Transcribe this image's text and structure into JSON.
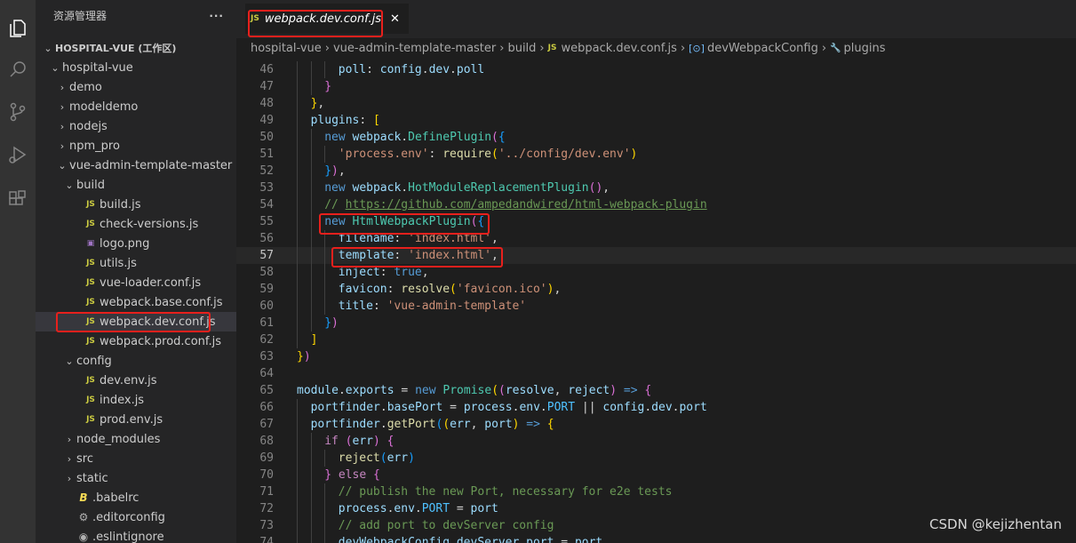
{
  "sidebar": {
    "title": "资源管理器",
    "more": "···",
    "tree": [
      {
        "label": "HOSPITAL-VUE (工作区)",
        "chev": "⌄",
        "icon": "",
        "depth": 0,
        "bold": true
      },
      {
        "label": "hospital-vue",
        "chev": "⌄",
        "icon": "",
        "depth": 1
      },
      {
        "label": "demo",
        "chev": "›",
        "icon": "",
        "depth": 2
      },
      {
        "label": "modeldemo",
        "chev": "›",
        "icon": "",
        "depth": 2
      },
      {
        "label": "nodejs",
        "chev": "›",
        "icon": "",
        "depth": 2
      },
      {
        "label": "npm_pro",
        "chev": "›",
        "icon": "",
        "depth": 2
      },
      {
        "label": "vue-admin-template-master",
        "chev": "⌄",
        "icon": "",
        "depth": 2
      },
      {
        "label": "build",
        "chev": "⌄",
        "icon": "",
        "depth": 3
      },
      {
        "label": "build.js",
        "chev": "",
        "icon": "JS",
        "depth": 4
      },
      {
        "label": "check-versions.js",
        "chev": "",
        "icon": "JS",
        "depth": 4
      },
      {
        "label": "logo.png",
        "chev": "",
        "icon": "▣",
        "depth": 4
      },
      {
        "label": "utils.js",
        "chev": "",
        "icon": "JS",
        "depth": 4
      },
      {
        "label": "vue-loader.conf.js",
        "chev": "",
        "icon": "JS",
        "depth": 4
      },
      {
        "label": "webpack.base.conf.js",
        "chev": "",
        "icon": "JS",
        "depth": 4
      },
      {
        "label": "webpack.dev.conf.js",
        "chev": "",
        "icon": "JS",
        "depth": 4,
        "selected": true
      },
      {
        "label": "webpack.prod.conf.js",
        "chev": "",
        "icon": "JS",
        "depth": 4
      },
      {
        "label": "config",
        "chev": "⌄",
        "icon": "",
        "depth": 3
      },
      {
        "label": "dev.env.js",
        "chev": "",
        "icon": "JS",
        "depth": 4
      },
      {
        "label": "index.js",
        "chev": "",
        "icon": "JS",
        "depth": 4
      },
      {
        "label": "prod.env.js",
        "chev": "",
        "icon": "JS",
        "depth": 4
      },
      {
        "label": "node_modules",
        "chev": "›",
        "icon": "",
        "depth": 3
      },
      {
        "label": "src",
        "chev": "›",
        "icon": "",
        "depth": 3
      },
      {
        "label": "static",
        "chev": "›",
        "icon": "",
        "depth": 3
      },
      {
        "label": ".babelrc",
        "chev": "",
        "icon": "B",
        "depth": 3
      },
      {
        "label": ".editorconfig",
        "chev": "",
        "icon": "⚙",
        "depth": 3
      },
      {
        "label": ".eslintignore",
        "chev": "",
        "icon": "◉",
        "depth": 3
      }
    ]
  },
  "tab": {
    "icon": "JS",
    "label": "webpack.dev.conf.js",
    "close": "✕"
  },
  "breadcrumb": {
    "parts": [
      "hospital-vue",
      "vue-admin-template-master",
      "build"
    ],
    "file_icon": "JS",
    "file": "webpack.dev.conf.js",
    "symbol_icon": "[⊙]",
    "symbol": "devWebpackConfig",
    "prop_icon": "🔧",
    "prop": "plugins",
    "sep": "›"
  },
  "editor": {
    "current_line": 57,
    "lines": [
      {
        "n": "46",
        "i": 3,
        "t": [
          [
            "var",
            "poll"
          ],
          [
            "pun",
            ": "
          ],
          [
            "var",
            "config"
          ],
          [
            "pun",
            "."
          ],
          [
            "var",
            "dev"
          ],
          [
            "pun",
            "."
          ],
          [
            "var",
            "poll"
          ]
        ]
      },
      {
        "n": "47",
        "i": 2,
        "t": [
          [
            "br2",
            "}"
          ]
        ]
      },
      {
        "n": "48",
        "i": 1,
        "t": [
          [
            "br1",
            "}"
          ],
          [
            "pun",
            ","
          ]
        ]
      },
      {
        "n": "49",
        "i": 1,
        "t": [
          [
            "var",
            "plugins"
          ],
          [
            "pun",
            ": "
          ],
          [
            "br1",
            "["
          ]
        ]
      },
      {
        "n": "50",
        "i": 2,
        "t": [
          [
            "kw",
            "new "
          ],
          [
            "var",
            "webpack"
          ],
          [
            "pun",
            "."
          ],
          [
            "cls",
            "DefinePlugin"
          ],
          [
            "br2",
            "("
          ],
          [
            "br3",
            "{"
          ]
        ]
      },
      {
        "n": "51",
        "i": 3,
        "t": [
          [
            "str",
            "'process.env'"
          ],
          [
            "pun",
            ": "
          ],
          [
            "fn",
            "require"
          ],
          [
            "br1",
            "("
          ],
          [
            "str",
            "'../config/dev.env'"
          ],
          [
            "br1",
            ")"
          ]
        ]
      },
      {
        "n": "52",
        "i": 2,
        "t": [
          [
            "br3",
            "}"
          ],
          [
            "br2",
            ")"
          ],
          [
            "pun",
            ","
          ]
        ]
      },
      {
        "n": "53",
        "i": 2,
        "t": [
          [
            "kw",
            "new "
          ],
          [
            "var",
            "webpack"
          ],
          [
            "pun",
            "."
          ],
          [
            "cls",
            "HotModuleReplacementPlugin"
          ],
          [
            "br2",
            "()"
          ],
          [
            "pun",
            ","
          ]
        ]
      },
      {
        "n": "54",
        "i": 2,
        "t": [
          [
            "cm",
            "// "
          ],
          [
            "link",
            "https://github.com/ampedandwired/html-webpack-plugin"
          ]
        ]
      },
      {
        "n": "55",
        "i": 2,
        "t": [
          [
            "kw",
            "new "
          ],
          [
            "cls",
            "HtmlWebpackPlugin"
          ],
          [
            "br2",
            "("
          ],
          [
            "br3",
            "{"
          ]
        ]
      },
      {
        "n": "56",
        "i": 3,
        "t": [
          [
            "var",
            "filename"
          ],
          [
            "pun",
            ": "
          ],
          [
            "str",
            "'index.html'"
          ],
          [
            "pun",
            ","
          ]
        ]
      },
      {
        "n": "57",
        "i": 3,
        "t": [
          [
            "var",
            "template"
          ],
          [
            "pun",
            ": "
          ],
          [
            "str",
            "'index.html'"
          ],
          [
            "pun",
            ","
          ]
        ]
      },
      {
        "n": "58",
        "i": 3,
        "t": [
          [
            "var",
            "inject"
          ],
          [
            "pun",
            ": "
          ],
          [
            "kw",
            "true"
          ],
          [
            "pun",
            ","
          ]
        ]
      },
      {
        "n": "59",
        "i": 3,
        "t": [
          [
            "var",
            "favicon"
          ],
          [
            "pun",
            ": "
          ],
          [
            "fn",
            "resolve"
          ],
          [
            "br1",
            "("
          ],
          [
            "str",
            "'favicon.ico'"
          ],
          [
            "br1",
            ")"
          ],
          [
            "pun",
            ","
          ]
        ]
      },
      {
        "n": "60",
        "i": 3,
        "t": [
          [
            "var",
            "title"
          ],
          [
            "pun",
            ": "
          ],
          [
            "str",
            "'vue-admin-template'"
          ]
        ]
      },
      {
        "n": "61",
        "i": 2,
        "t": [
          [
            "br3",
            "}"
          ],
          [
            "br2",
            ")"
          ]
        ]
      },
      {
        "n": "62",
        "i": 1,
        "t": [
          [
            "br1",
            "]"
          ]
        ]
      },
      {
        "n": "63",
        "i": 0,
        "t": [
          [
            "br1",
            "}"
          ],
          [
            "br2",
            ")"
          ]
        ]
      },
      {
        "n": "64",
        "i": 0,
        "t": []
      },
      {
        "n": "65",
        "i": 0,
        "t": [
          [
            "var",
            "module"
          ],
          [
            "pun",
            "."
          ],
          [
            "var",
            "exports"
          ],
          [
            "pun",
            " = "
          ],
          [
            "kw",
            "new "
          ],
          [
            "cls",
            "Promise"
          ],
          [
            "br1",
            "("
          ],
          [
            "br2",
            "("
          ],
          [
            "var",
            "resolve"
          ],
          [
            "pun",
            ", "
          ],
          [
            "var",
            "reject"
          ],
          [
            "br2",
            ")"
          ],
          [
            "kw",
            " => "
          ],
          [
            "br2",
            "{"
          ]
        ]
      },
      {
        "n": "66",
        "i": 1,
        "t": [
          [
            "var",
            "portfinder"
          ],
          [
            "pun",
            "."
          ],
          [
            "var",
            "basePort"
          ],
          [
            "pun",
            " = "
          ],
          [
            "var",
            "process"
          ],
          [
            "pun",
            "."
          ],
          [
            "var",
            "env"
          ],
          [
            "pun",
            "."
          ],
          [
            "con",
            "PORT"
          ],
          [
            "pun",
            " || "
          ],
          [
            "var",
            "config"
          ],
          [
            "pun",
            "."
          ],
          [
            "var",
            "dev"
          ],
          [
            "pun",
            "."
          ],
          [
            "var",
            "port"
          ]
        ]
      },
      {
        "n": "67",
        "i": 1,
        "t": [
          [
            "var",
            "portfinder"
          ],
          [
            "pun",
            "."
          ],
          [
            "fn",
            "getPort"
          ],
          [
            "br3",
            "("
          ],
          [
            "br1",
            "("
          ],
          [
            "var",
            "err"
          ],
          [
            "pun",
            ", "
          ],
          [
            "var",
            "port"
          ],
          [
            "br1",
            ")"
          ],
          [
            "kw",
            " => "
          ],
          [
            "br1",
            "{"
          ]
        ]
      },
      {
        "n": "68",
        "i": 2,
        "t": [
          [
            "ctl",
            "if "
          ],
          [
            "br2",
            "("
          ],
          [
            "var",
            "err"
          ],
          [
            "br2",
            ")"
          ],
          [
            "pun",
            " "
          ],
          [
            "br2",
            "{"
          ]
        ]
      },
      {
        "n": "69",
        "i": 3,
        "t": [
          [
            "fn",
            "reject"
          ],
          [
            "br3",
            "("
          ],
          [
            "var",
            "err"
          ],
          [
            "br3",
            ")"
          ]
        ]
      },
      {
        "n": "70",
        "i": 2,
        "t": [
          [
            "br2",
            "}"
          ],
          [
            "pun",
            " "
          ],
          [
            "ctl",
            "else "
          ],
          [
            "br2",
            "{"
          ]
        ]
      },
      {
        "n": "71",
        "i": 3,
        "t": [
          [
            "cm",
            "// publish the new Port, necessary for e2e tests"
          ]
        ]
      },
      {
        "n": "72",
        "i": 3,
        "t": [
          [
            "var",
            "process"
          ],
          [
            "pun",
            "."
          ],
          [
            "var",
            "env"
          ],
          [
            "pun",
            "."
          ],
          [
            "con",
            "PORT"
          ],
          [
            "pun",
            " = "
          ],
          [
            "var",
            "port"
          ]
        ]
      },
      {
        "n": "73",
        "i": 3,
        "t": [
          [
            "cm",
            "// add port to devServer config"
          ]
        ]
      },
      {
        "n": "74",
        "i": 3,
        "t": [
          [
            "var",
            "devWebpackConfig"
          ],
          [
            "pun",
            "."
          ],
          [
            "var",
            "devServer"
          ],
          [
            "pun",
            "."
          ],
          [
            "var",
            "port"
          ],
          [
            "pun",
            " = "
          ],
          [
            "var",
            "port"
          ]
        ]
      }
    ]
  },
  "watermark": "CSDN @kejizhentan"
}
